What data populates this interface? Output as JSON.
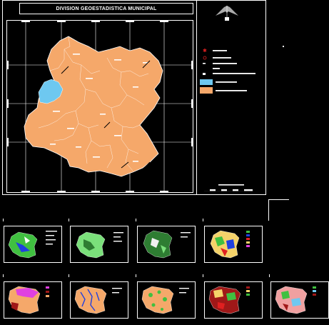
{
  "main": {
    "title": "DIVISION GEOESTADISTICA MUNICIPAL"
  },
  "colors": {
    "background": "#000000",
    "municipality_fill": "#f5a86a",
    "lake_fill": "#6ec8f0",
    "lines": "#ffffff",
    "legend_red": "#e02020",
    "thumb_green": "#40c040",
    "thumb_light_green": "#7be07b",
    "thumb_dark_green": "#2e7d32",
    "thumb_magenta": "#e040e0",
    "thumb_blue": "#2040e0",
    "thumb_dark_red": "#a01818"
  },
  "icons": [
    "north-arrow-icon",
    "scale-bar-icon"
  ],
  "thumbnails": [
    {
      "theme": "green-blue"
    },
    {
      "theme": "light-green"
    },
    {
      "theme": "dark-green"
    },
    {
      "theme": "multicolor"
    },
    {
      "theme": "magenta"
    },
    {
      "theme": "blue-lines"
    },
    {
      "theme": "green-dots"
    },
    {
      "theme": "red-green"
    },
    {
      "theme": "pink-mix"
    }
  ]
}
